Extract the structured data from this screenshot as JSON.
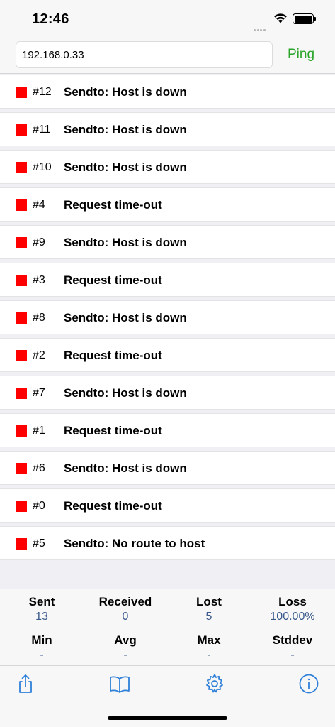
{
  "status_bar": {
    "time": "12:46"
  },
  "address": {
    "host": "192.168.0.33",
    "ping_label": "Ping"
  },
  "results": [
    {
      "seq": "#12",
      "message": "Sendto: Host is down"
    },
    {
      "seq": "#11",
      "message": "Sendto: Host is down"
    },
    {
      "seq": "#10",
      "message": "Sendto: Host is down"
    },
    {
      "seq": "#4",
      "message": "Request time-out"
    },
    {
      "seq": "#9",
      "message": "Sendto: Host is down"
    },
    {
      "seq": "#3",
      "message": "Request time-out"
    },
    {
      "seq": "#8",
      "message": "Sendto: Host is down"
    },
    {
      "seq": "#2",
      "message": "Request time-out"
    },
    {
      "seq": "#7",
      "message": "Sendto: Host is down"
    },
    {
      "seq": "#1",
      "message": "Request time-out"
    },
    {
      "seq": "#6",
      "message": "Sendto: Host is down"
    },
    {
      "seq": "#0",
      "message": "Request time-out"
    },
    {
      "seq": "#5",
      "message": "Sendto: No route to host"
    }
  ],
  "stats": {
    "sent_label": "Sent",
    "sent": "13",
    "received_label": "Received",
    "received": "0",
    "lost_label": "Lost",
    "lost": "5",
    "loss_label": "Loss",
    "loss": "100.00%",
    "min_label": "Min",
    "min": "-",
    "avg_label": "Avg",
    "avg": "-",
    "max_label": "Max",
    "max": "-",
    "stddev_label": "Stddev",
    "stddev": "-"
  },
  "tabs": [
    "share-icon",
    "book-icon",
    "gear-icon",
    "info-icon"
  ],
  "colors": {
    "accent": "#2f80d8",
    "ping": "#2aa52a",
    "error": "#ff0000",
    "stat_value": "#3a5a8c"
  }
}
